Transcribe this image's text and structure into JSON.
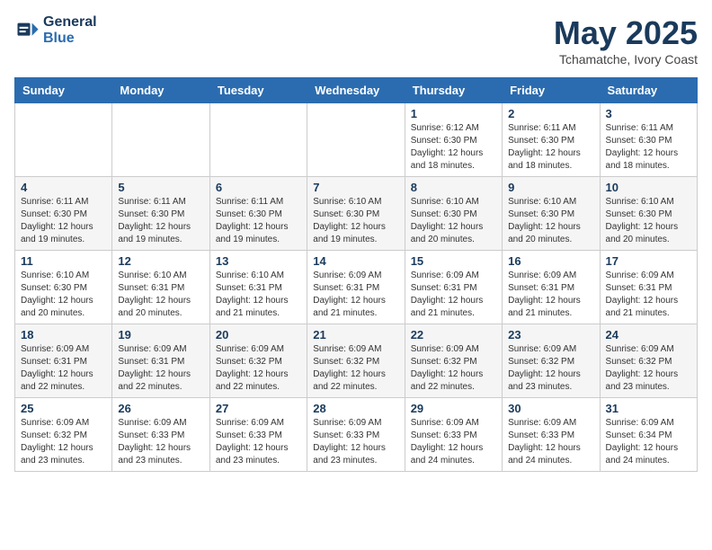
{
  "logo": {
    "line1": "General",
    "line2": "Blue"
  },
  "title": "May 2025",
  "location": "Tchamatche, Ivory Coast",
  "days_of_week": [
    "Sunday",
    "Monday",
    "Tuesday",
    "Wednesday",
    "Thursday",
    "Friday",
    "Saturday"
  ],
  "weeks": [
    [
      {
        "day": "",
        "info": ""
      },
      {
        "day": "",
        "info": ""
      },
      {
        "day": "",
        "info": ""
      },
      {
        "day": "",
        "info": ""
      },
      {
        "day": "1",
        "info": "Sunrise: 6:12 AM\nSunset: 6:30 PM\nDaylight: 12 hours\nand 18 minutes."
      },
      {
        "day": "2",
        "info": "Sunrise: 6:11 AM\nSunset: 6:30 PM\nDaylight: 12 hours\nand 18 minutes."
      },
      {
        "day": "3",
        "info": "Sunrise: 6:11 AM\nSunset: 6:30 PM\nDaylight: 12 hours\nand 18 minutes."
      }
    ],
    [
      {
        "day": "4",
        "info": "Sunrise: 6:11 AM\nSunset: 6:30 PM\nDaylight: 12 hours\nand 19 minutes."
      },
      {
        "day": "5",
        "info": "Sunrise: 6:11 AM\nSunset: 6:30 PM\nDaylight: 12 hours\nand 19 minutes."
      },
      {
        "day": "6",
        "info": "Sunrise: 6:11 AM\nSunset: 6:30 PM\nDaylight: 12 hours\nand 19 minutes."
      },
      {
        "day": "7",
        "info": "Sunrise: 6:10 AM\nSunset: 6:30 PM\nDaylight: 12 hours\nand 19 minutes."
      },
      {
        "day": "8",
        "info": "Sunrise: 6:10 AM\nSunset: 6:30 PM\nDaylight: 12 hours\nand 20 minutes."
      },
      {
        "day": "9",
        "info": "Sunrise: 6:10 AM\nSunset: 6:30 PM\nDaylight: 12 hours\nand 20 minutes."
      },
      {
        "day": "10",
        "info": "Sunrise: 6:10 AM\nSunset: 6:30 PM\nDaylight: 12 hours\nand 20 minutes."
      }
    ],
    [
      {
        "day": "11",
        "info": "Sunrise: 6:10 AM\nSunset: 6:30 PM\nDaylight: 12 hours\nand 20 minutes."
      },
      {
        "day": "12",
        "info": "Sunrise: 6:10 AM\nSunset: 6:31 PM\nDaylight: 12 hours\nand 20 minutes."
      },
      {
        "day": "13",
        "info": "Sunrise: 6:10 AM\nSunset: 6:31 PM\nDaylight: 12 hours\nand 21 minutes."
      },
      {
        "day": "14",
        "info": "Sunrise: 6:09 AM\nSunset: 6:31 PM\nDaylight: 12 hours\nand 21 minutes."
      },
      {
        "day": "15",
        "info": "Sunrise: 6:09 AM\nSunset: 6:31 PM\nDaylight: 12 hours\nand 21 minutes."
      },
      {
        "day": "16",
        "info": "Sunrise: 6:09 AM\nSunset: 6:31 PM\nDaylight: 12 hours\nand 21 minutes."
      },
      {
        "day": "17",
        "info": "Sunrise: 6:09 AM\nSunset: 6:31 PM\nDaylight: 12 hours\nand 21 minutes."
      }
    ],
    [
      {
        "day": "18",
        "info": "Sunrise: 6:09 AM\nSunset: 6:31 PM\nDaylight: 12 hours\nand 22 minutes."
      },
      {
        "day": "19",
        "info": "Sunrise: 6:09 AM\nSunset: 6:31 PM\nDaylight: 12 hours\nand 22 minutes."
      },
      {
        "day": "20",
        "info": "Sunrise: 6:09 AM\nSunset: 6:32 PM\nDaylight: 12 hours\nand 22 minutes."
      },
      {
        "day": "21",
        "info": "Sunrise: 6:09 AM\nSunset: 6:32 PM\nDaylight: 12 hours\nand 22 minutes."
      },
      {
        "day": "22",
        "info": "Sunrise: 6:09 AM\nSunset: 6:32 PM\nDaylight: 12 hours\nand 22 minutes."
      },
      {
        "day": "23",
        "info": "Sunrise: 6:09 AM\nSunset: 6:32 PM\nDaylight: 12 hours\nand 23 minutes."
      },
      {
        "day": "24",
        "info": "Sunrise: 6:09 AM\nSunset: 6:32 PM\nDaylight: 12 hours\nand 23 minutes."
      }
    ],
    [
      {
        "day": "25",
        "info": "Sunrise: 6:09 AM\nSunset: 6:32 PM\nDaylight: 12 hours\nand 23 minutes."
      },
      {
        "day": "26",
        "info": "Sunrise: 6:09 AM\nSunset: 6:33 PM\nDaylight: 12 hours\nand 23 minutes."
      },
      {
        "day": "27",
        "info": "Sunrise: 6:09 AM\nSunset: 6:33 PM\nDaylight: 12 hours\nand 23 minutes."
      },
      {
        "day": "28",
        "info": "Sunrise: 6:09 AM\nSunset: 6:33 PM\nDaylight: 12 hours\nand 23 minutes."
      },
      {
        "day": "29",
        "info": "Sunrise: 6:09 AM\nSunset: 6:33 PM\nDaylight: 12 hours\nand 24 minutes."
      },
      {
        "day": "30",
        "info": "Sunrise: 6:09 AM\nSunset: 6:33 PM\nDaylight: 12 hours\nand 24 minutes."
      },
      {
        "day": "31",
        "info": "Sunrise: 6:09 AM\nSunset: 6:34 PM\nDaylight: 12 hours\nand 24 minutes."
      }
    ]
  ]
}
